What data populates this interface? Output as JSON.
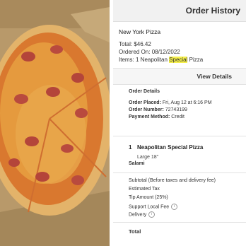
{
  "header": {
    "title": "Order History"
  },
  "order": {
    "store": "New York Pizza",
    "total": "Total: $46.42",
    "ordered_on": "Ordered On: 08/12/2022",
    "items_prefix": "Items: 1 Neapolitan ",
    "items_highlight": "Special",
    "items_suffix": " Pizza"
  },
  "view_details": {
    "label": "View Details"
  },
  "details": {
    "title": "Order Details",
    "placed_label": "Order Placed:",
    "placed_value": "Fri, Aug 12 at 6:16 PM",
    "number_label": "Order Number:",
    "number_value": "72743199",
    "payment_label": "Payment Method:",
    "payment_value": "Credit"
  },
  "item": {
    "qty": "1",
    "name": "Neapolitan Special Pizza",
    "size": "Large 18\"",
    "option": "Salami"
  },
  "fees": {
    "subtotal": "Subtotal (Before taxes and delivery fee)",
    "tax": "Estimated Tax",
    "tip": "Tip Amount (25%)",
    "local_fee": "Support Local Fee",
    "delivery": "Delivery",
    "info_glyph": "i"
  },
  "total_label": "Total",
  "colors": {
    "highlight": "#f5ef4b",
    "header_bg": "#f1f1f1"
  }
}
